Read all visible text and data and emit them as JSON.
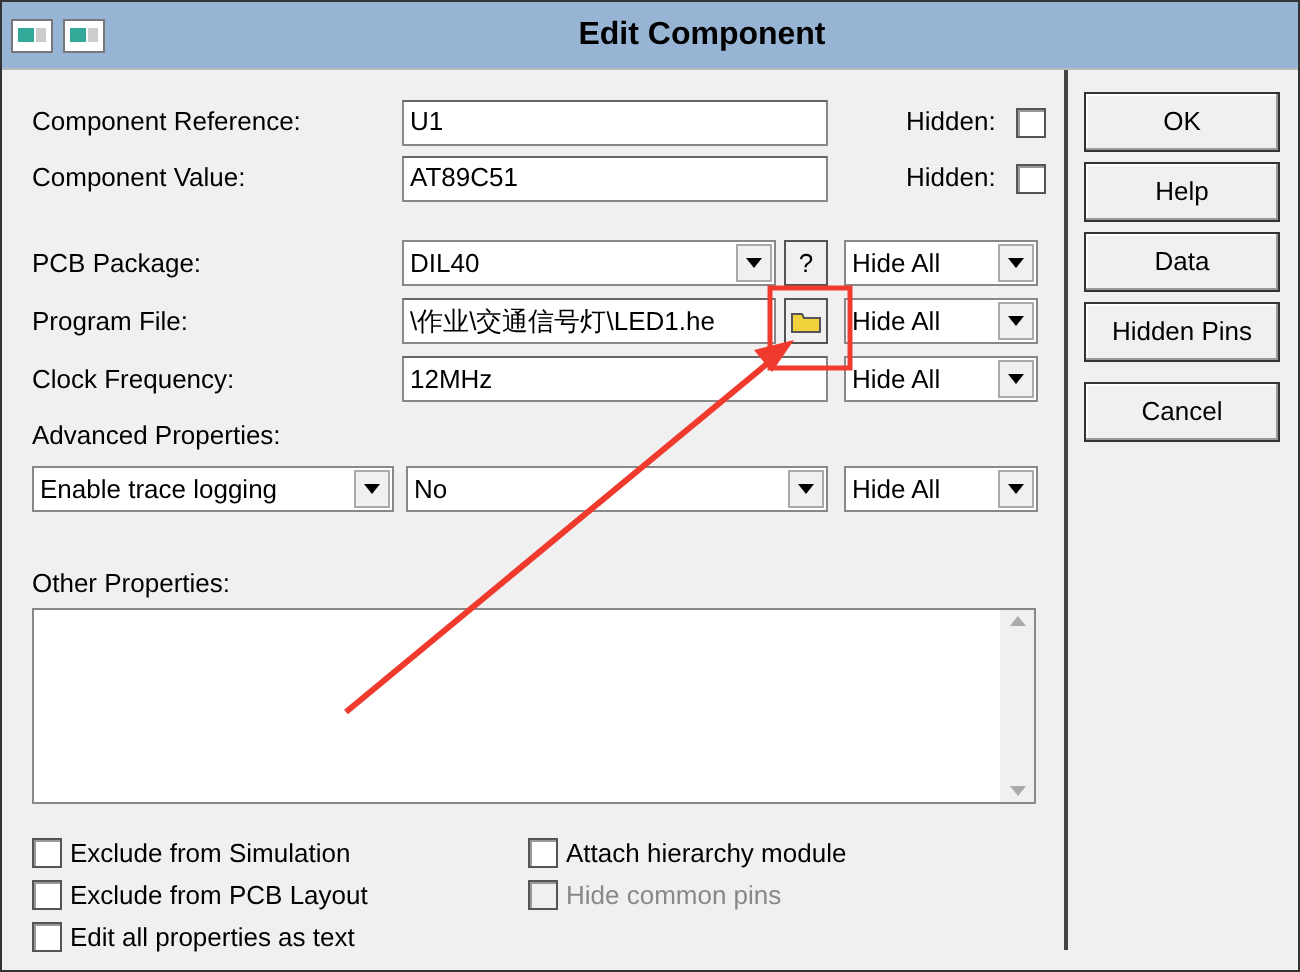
{
  "window": {
    "title": "Edit Component"
  },
  "fields": [
    {
      "label": "Component Reference:",
      "value": "U1",
      "hidden_label": "Hidden:",
      "hidden": false
    },
    {
      "label": "Component Value:",
      "value": "AT89C51",
      "hidden_label": "Hidden:",
      "hidden": false
    }
  ],
  "properties": [
    {
      "kind": "combo_help",
      "label": "PCB Package:",
      "value": "DIL40",
      "help": "?",
      "visibility": "Hide All"
    },
    {
      "kind": "file",
      "label": "Program File:",
      "value": "\\作业\\交通信号灯\\LED1.he",
      "visibility": "Hide All"
    },
    {
      "kind": "text",
      "label": "Clock Frequency:",
      "value": "12MHz",
      "visibility": "Hide All"
    }
  ],
  "advanced": {
    "label": "Advanced Properties:",
    "property": "Enable trace logging",
    "value": "No",
    "visibility": "Hide All"
  },
  "other_properties": {
    "label": "Other Properties:"
  },
  "checkbox_columns": [
    [
      {
        "label": "Exclude from Simulation",
        "checked": false,
        "disabled": false
      },
      {
        "label": "Exclude from PCB Layout",
        "checked": false,
        "disabled": false
      },
      {
        "label": "Edit all properties as text",
        "checked": false,
        "disabled": false
      }
    ],
    [
      {
        "label": "Attach hierarchy module",
        "checked": false,
        "disabled": false
      },
      {
        "label": "Hide common pins",
        "checked": false,
        "disabled": true
      }
    ]
  ],
  "button_groups": [
    [
      "OK",
      "Help",
      "Data",
      "Hidden Pins"
    ],
    [
      "Cancel"
    ]
  ],
  "annotation": {
    "kind": "arrow_to_box"
  }
}
